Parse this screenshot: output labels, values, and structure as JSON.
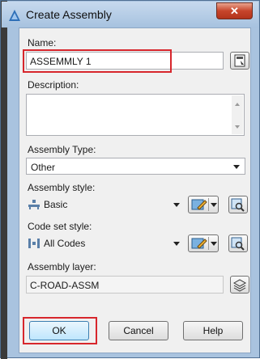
{
  "window": {
    "title": "Create Assembly",
    "close_glyph": "✕"
  },
  "fields": {
    "name_label": "Name:",
    "name_value": "ASSEMMLY 1",
    "description_label": "Description:",
    "description_value": "",
    "assembly_type_label": "Assembly Type:",
    "assembly_type_value": "Other",
    "assembly_style_label": "Assembly style:",
    "assembly_style_value": "Basic",
    "code_set_style_label": "Code set style:",
    "code_set_style_value": "All Codes",
    "assembly_layer_label": "Assembly layer:",
    "assembly_layer_value": "C-ROAD-ASSM"
  },
  "buttons": {
    "ok": "OK",
    "cancel": "Cancel",
    "help": "Help"
  },
  "highlight_color": "#d7262c"
}
